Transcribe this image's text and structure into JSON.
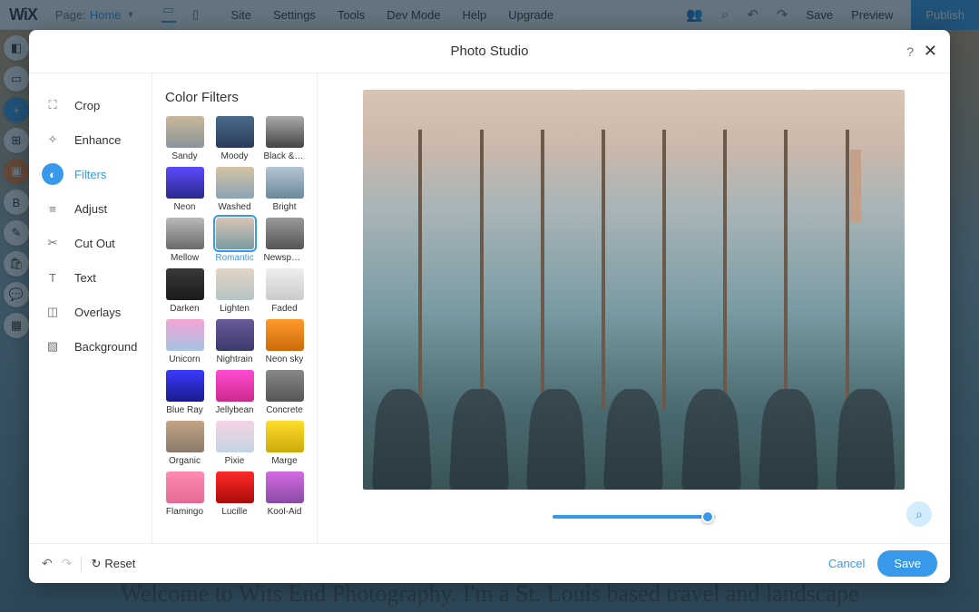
{
  "topbar": {
    "logo": "WiX",
    "page_label": "Page:",
    "page_name": "Home",
    "menu": [
      "Site",
      "Settings",
      "Tools",
      "Dev Mode",
      "Help",
      "Upgrade"
    ],
    "save": "Save",
    "preview": "Preview",
    "publish": "Publish"
  },
  "bg_text": "Welcome to Wits End Photography. I'm a St. Louis based travel and landscape",
  "modal": {
    "title": "Photo Studio"
  },
  "tools": [
    {
      "id": "crop",
      "label": "Crop",
      "icon": "⛶"
    },
    {
      "id": "enhance",
      "label": "Enhance",
      "icon": "✧"
    },
    {
      "id": "filters",
      "label": "Filters",
      "icon": "◐",
      "active": true
    },
    {
      "id": "adjust",
      "label": "Adjust",
      "icon": "≡"
    },
    {
      "id": "cutout",
      "label": "Cut Out",
      "icon": "✂"
    },
    {
      "id": "text",
      "label": "Text",
      "icon": "T"
    },
    {
      "id": "overlays",
      "label": "Overlays",
      "icon": "◫"
    },
    {
      "id": "background",
      "label": "Background",
      "icon": "▧"
    }
  ],
  "filters_title": "Color Filters",
  "filters": [
    {
      "name": "Sandy",
      "cls": "t-sandy"
    },
    {
      "name": "Moody",
      "cls": "t-moody"
    },
    {
      "name": "Black & …",
      "cls": "t-bw"
    },
    {
      "name": "Neon",
      "cls": "t-neon"
    },
    {
      "name": "Washed",
      "cls": "t-washed"
    },
    {
      "name": "Bright",
      "cls": "t-bright"
    },
    {
      "name": "Mellow",
      "cls": "t-mellow"
    },
    {
      "name": "Romantic",
      "cls": "t-romantic",
      "selected": true
    },
    {
      "name": "Newspa…",
      "cls": "t-news"
    },
    {
      "name": "Darken",
      "cls": "t-darken"
    },
    {
      "name": "Lighten",
      "cls": "t-lighten"
    },
    {
      "name": "Faded",
      "cls": "t-faded"
    },
    {
      "name": "Unicorn",
      "cls": "t-unicorn"
    },
    {
      "name": "Nightrain",
      "cls": "t-night"
    },
    {
      "name": "Neon sky",
      "cls": "t-neonsky"
    },
    {
      "name": "Blue Ray",
      "cls": "t-blueray"
    },
    {
      "name": "Jellybean",
      "cls": "t-jelly"
    },
    {
      "name": "Concrete",
      "cls": "t-concrete"
    },
    {
      "name": "Organic",
      "cls": "t-organic"
    },
    {
      "name": "Pixie",
      "cls": "t-pixie"
    },
    {
      "name": "Marge",
      "cls": "t-marge"
    },
    {
      "name": "Flamingo",
      "cls": "t-flamingo"
    },
    {
      "name": "Lucille",
      "cls": "t-lucille"
    },
    {
      "name": "Kool-Aid",
      "cls": "t-koolaid"
    }
  ],
  "slider": {
    "value": 95
  },
  "footer": {
    "reset": "Reset",
    "cancel": "Cancel",
    "save": "Save"
  }
}
